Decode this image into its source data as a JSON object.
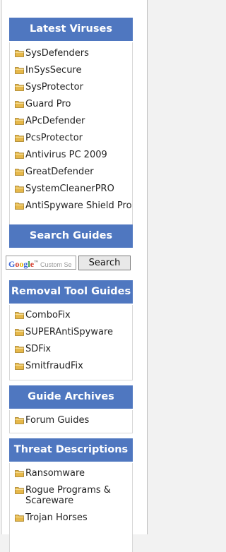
{
  "latest_viruses": {
    "title": "Latest Viruses",
    "items": [
      "SysDefenders",
      "InSysSecure",
      "SysProtector",
      "Guard Pro",
      "APcDefender",
      "PcsProtector",
      "Antivirus PC 2009",
      "GreatDefender",
      "SystemCleanerPRO",
      "AntiSpyware Shield Pro"
    ]
  },
  "search_guides": {
    "title": "Search Guides",
    "placeholder": "Custom Se",
    "logo_text": "Google™",
    "button_label": "Search"
  },
  "removal_tools": {
    "title": "Removal Tool Guides",
    "items": [
      "ComboFix",
      "SUPERAntiSpyware",
      "SDFix",
      "SmitfraudFix"
    ]
  },
  "guide_archives": {
    "title": "Guide Archives",
    "items": [
      "Forum Guides"
    ]
  },
  "threat_descriptions": {
    "title": "Threat Descriptions",
    "items": [
      "Ransomware",
      "Rogue Programs & Scareware",
      "Trojan Horses"
    ]
  },
  "colors": {
    "header_bg": "#4f77c0",
    "folder": "#e6b84a"
  }
}
